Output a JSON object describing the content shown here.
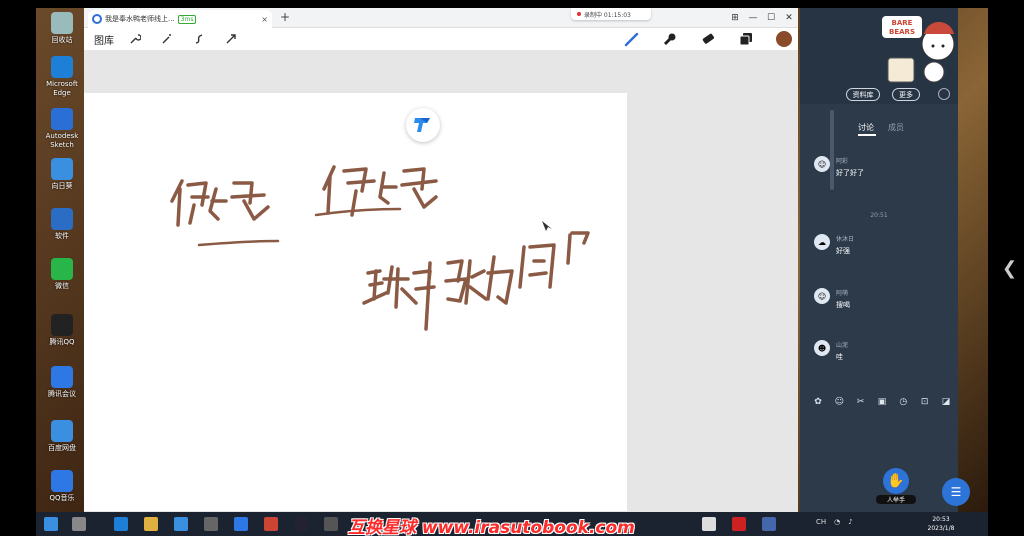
{
  "desktop_icons": [
    {
      "label": "回收站",
      "color": "#9bb"
    },
    {
      "label": "Microsoft Edge",
      "color": "#1d7fd6"
    },
    {
      "label": "Autodesk Sketch",
      "color": "#2a6fd6"
    },
    {
      "label": "向日葵",
      "color": "#3a8fe0"
    },
    {
      "label": "软件",
      "color": "#2b6cc4"
    },
    {
      "label": "微信",
      "color": "#28b648"
    },
    {
      "label": "腾讯QQ",
      "color": "#222"
    },
    {
      "label": "腾讯会议",
      "color": "#2e78e6"
    },
    {
      "label": "百度网盘",
      "color": "#3a8fe0"
    },
    {
      "label": "QQ音乐",
      "color": "#2e78e6"
    }
  ],
  "browser": {
    "tab_title": "我是奉水鸭老师线上...",
    "tab_badge": "3ms",
    "tab_close": "×",
    "new_tab": "+",
    "recording_text": "录制中 01:15:03",
    "window_controls": [
      "⊞",
      "—",
      "☐",
      "✕"
    ]
  },
  "toolbar": {
    "library_label": "图库",
    "tools_left": [
      "wrench-icon",
      "magic-wand-icon",
      "curve-icon",
      "arrow-icon"
    ],
    "tools_right": [
      "pen-icon",
      "brush-icon",
      "eraser-icon",
      "layers-icon",
      "color-swatch"
    ],
    "accent": "#2f6fd6",
    "brush_color": "#8a5a44"
  },
  "chat": {
    "header_buttons": {
      "library": "资料库",
      "more": "更多"
    },
    "tabs": {
      "discussion": "讨论",
      "members": "成员"
    },
    "time_divider": "20:51",
    "messages": [
      {
        "name": "阿彩",
        "text": "好了好了",
        "avatar": "☺"
      },
      {
        "name": "休沐日",
        "text": "好强",
        "avatar": "☁"
      },
      {
        "name": "阿萌",
        "text": "搜喝",
        "avatar": "☺"
      },
      {
        "name": "山泥",
        "text": "哇",
        "avatar": "☻"
      }
    ],
    "raise_hand_label": "人举手",
    "bg": "#2c3a4a"
  },
  "taskbar": {
    "watermark": "互换星球 www.irasutobook.com",
    "tray_text": "CH",
    "time": "20:53",
    "date": "2023/1/8"
  }
}
